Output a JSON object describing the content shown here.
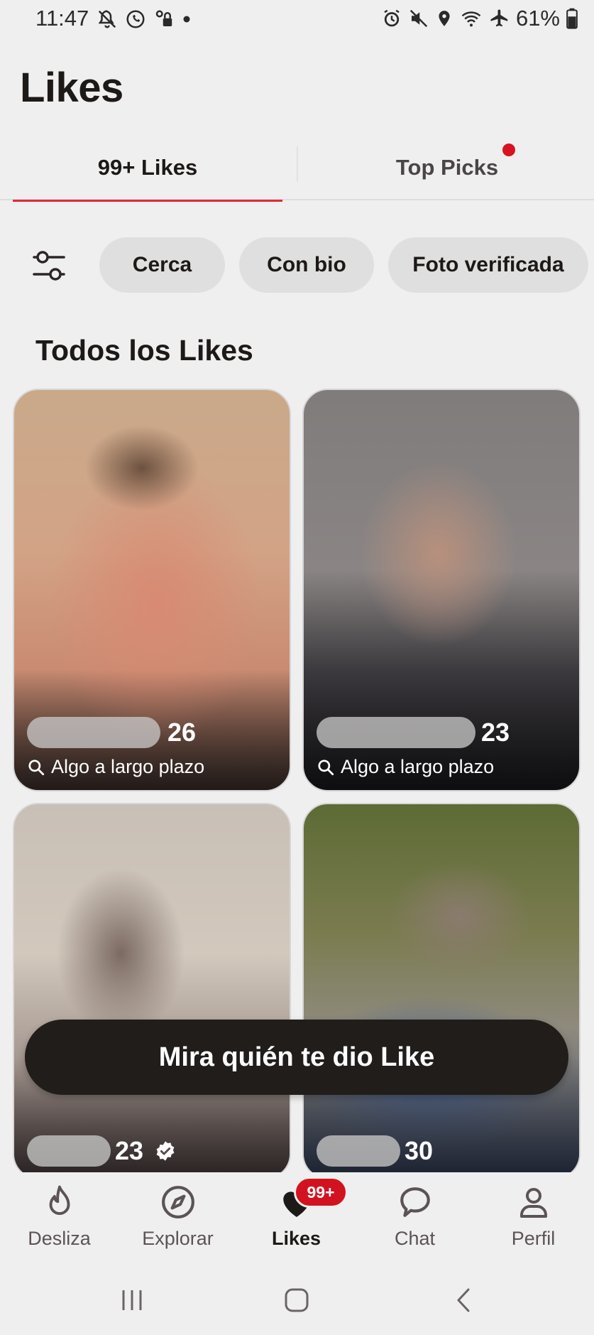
{
  "status_bar": {
    "time": "11:47",
    "battery": "61%",
    "icons_left": [
      "notifications-off-icon",
      "whatsapp-icon",
      "vpn-key-icon",
      "dot-icon"
    ],
    "icons_right": [
      "alarm-icon",
      "mute-icon",
      "location-icon",
      "wifi-icon",
      "airplane-icon",
      "battery-icon"
    ]
  },
  "header": {
    "title": "Likes"
  },
  "tabs": [
    {
      "label": "99+ Likes",
      "active": true
    },
    {
      "label": "Top Picks",
      "has_notification_dot": true
    }
  ],
  "filters": {
    "icon": "filter-sliders-icon",
    "chips": [
      "Cerca",
      "Con bio",
      "Foto verificada"
    ]
  },
  "section": {
    "title": "Todos los Likes"
  },
  "cards": [
    {
      "age": "26",
      "intent": "Algo a largo plazo"
    },
    {
      "age": "23",
      "intent": "Algo a largo plazo"
    },
    {
      "age": "23",
      "verified": true
    },
    {
      "age": "30"
    }
  ],
  "cta": {
    "label": "Mira quién te dio Like"
  },
  "bottom_nav": {
    "items": [
      {
        "label": "Desliza",
        "icon": "flame-icon"
      },
      {
        "label": "Explorar",
        "icon": "compass-icon"
      },
      {
        "label": "Likes",
        "icon": "heart-icon",
        "active": true,
        "badge": "99+"
      },
      {
        "label": "Chat",
        "icon": "chat-bubble-icon"
      },
      {
        "label": "Perfil",
        "icon": "person-icon"
      }
    ]
  },
  "colors": {
    "accent": "#e02a34",
    "badge": "#d3121f",
    "background": "#f0eff0",
    "chip": "#e0dfe0",
    "cta": "#211d1b"
  }
}
